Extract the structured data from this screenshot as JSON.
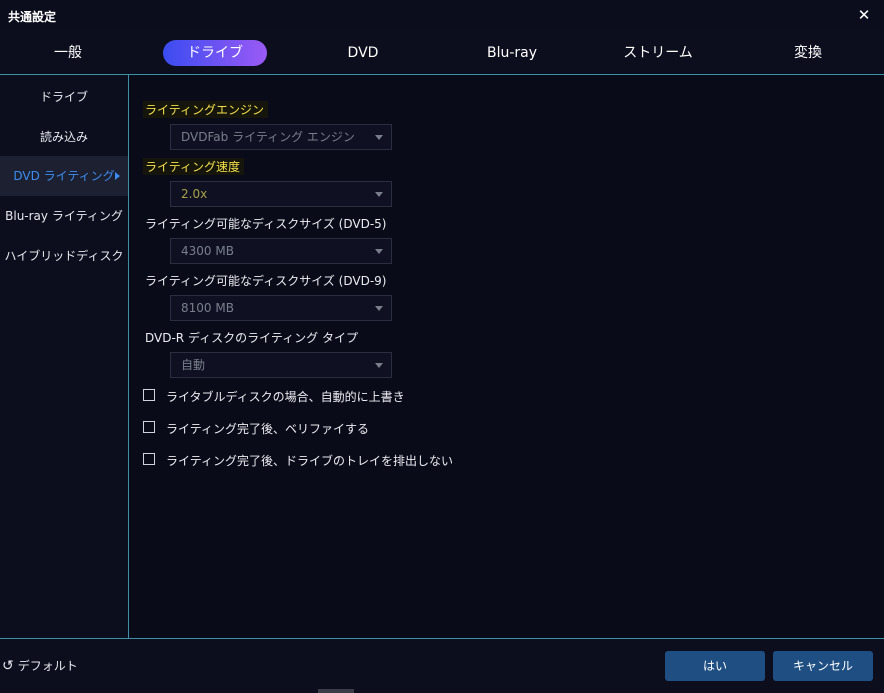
{
  "window": {
    "title": "共通設定"
  },
  "tabs": [
    {
      "label": "一般",
      "active": false
    },
    {
      "label": "ドライブ",
      "active": true
    },
    {
      "label": "DVD",
      "active": false
    },
    {
      "label": "Blu-ray",
      "active": false
    },
    {
      "label": "ストリーム",
      "active": false
    },
    {
      "label": "変換",
      "active": false
    }
  ],
  "sidebar": {
    "items": [
      {
        "label": "ドライブ",
        "active": false
      },
      {
        "label": "読み込み",
        "active": false
      },
      {
        "label": "DVD ライティング",
        "active": true
      },
      {
        "label": "Blu-ray ライティング",
        "active": false
      },
      {
        "label": "ハイブリッドディスク",
        "active": false
      }
    ]
  },
  "fields": {
    "engine": {
      "label": "ライティングエンジン",
      "value": "DVDFab ライティング エンジン"
    },
    "speed": {
      "label": "ライティング速度",
      "value": "2.0x"
    },
    "dvd5": {
      "label": "ライティング可能なディスクサイズ (DVD-5)",
      "value": "4300 MB"
    },
    "dvd9": {
      "label": "ライティング可能なディスクサイズ (DVD-9)",
      "value": "8100 MB"
    },
    "dvdr": {
      "label": "DVD-R ディスクのライティング タイプ",
      "value": "自動"
    }
  },
  "checkboxes": [
    {
      "label": "ライタブルディスクの場合、自動的に上書き",
      "checked": false
    },
    {
      "label": "ライティング完了後、ベリファイする",
      "checked": false
    },
    {
      "label": "ライティング完了後、ドライブのトレイを排出しない",
      "checked": false
    }
  ],
  "footer": {
    "default_label": "デフォルト",
    "ok_label": "はい",
    "cancel_label": "キャンセル"
  },
  "colors": {
    "accent": "#3d8df0",
    "highlight": "#f2e04a",
    "divider": "#3f8fa8",
    "button": "#1f4f82"
  },
  "icons": {
    "close": "close-icon",
    "reset": "reset-icon",
    "arrow": "chevron-right-icon",
    "caret": "chevron-down-icon"
  }
}
